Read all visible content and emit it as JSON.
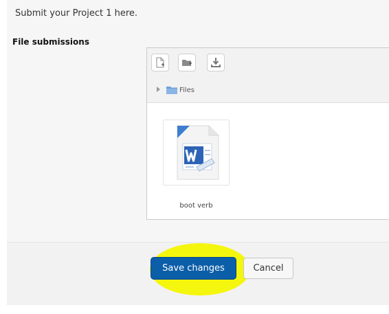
{
  "intro": {
    "text": "Submit your Project 1 here."
  },
  "submission": {
    "label": "File submissions",
    "toolbar": {
      "buttons": [
        {
          "icon": "add-file-icon"
        },
        {
          "icon": "create-folder-icon"
        },
        {
          "icon": "download-icon"
        }
      ]
    },
    "path": {
      "folder_icon": "folder-icon",
      "label": "Files"
    },
    "files": [
      {
        "name": "boot verb",
        "icon": "word-document-icon"
      }
    ]
  },
  "actions": {
    "save_label": "Save changes",
    "cancel_label": "Cancel",
    "highlight_color": "#f4f500",
    "primary_color": "#0b5ea8"
  }
}
